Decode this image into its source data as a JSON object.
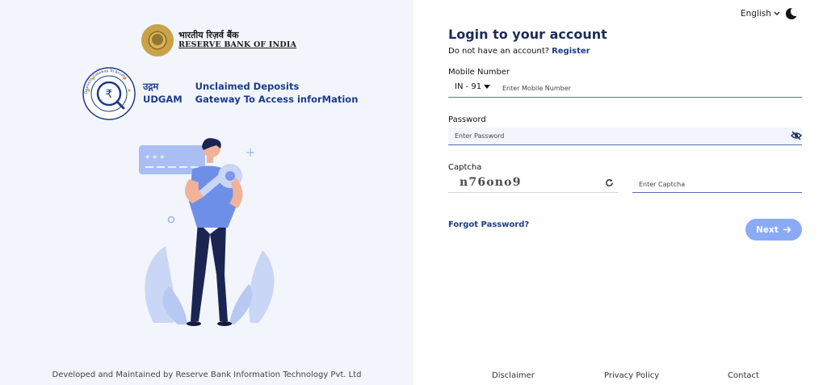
{
  "branding": {
    "rbi_hindi": "भारतीय रिज़र्व बैंक",
    "rbi_english": "RESERVE BANK OF INDIA",
    "udgam_hindi": "उद्गम",
    "udgam_short": "UDGAM",
    "udgam_line1": "Unclaimed Deposits",
    "udgam_line2": "Gateway To Access inforMation",
    "udgam_ring_text": "Deposits Gateway To Access"
  },
  "left_footer": "Developed and Maintained by Reserve Bank Information Technology Pvt. Ltd",
  "header": {
    "language": "English",
    "theme_icon": "dark-mode-icon"
  },
  "login": {
    "title": "Login to your account",
    "no_account_text": "Do not have an account?",
    "register_link": "Register",
    "mobile_label": "Mobile Number",
    "country_code": "IN - 91",
    "mobile_placeholder": "Enter Mobile Number",
    "password_label": "Password",
    "password_placeholder": "Enter Password",
    "captcha_label": "Captcha",
    "captcha_text": "n76ono9",
    "captcha_placeholder": "Enter Captcha",
    "forgot_link": "Forgot Password?",
    "next_label": "Next"
  },
  "footer_links": {
    "disclaimer": "Disclaimer",
    "privacy": "Privacy Policy",
    "contact": "Contact"
  },
  "colors": {
    "brand_navy": "#1d3b8c",
    "title_navy": "#1d2b57",
    "left_bg": "#f2f5fb",
    "button_blue": "#8aaaf6"
  }
}
